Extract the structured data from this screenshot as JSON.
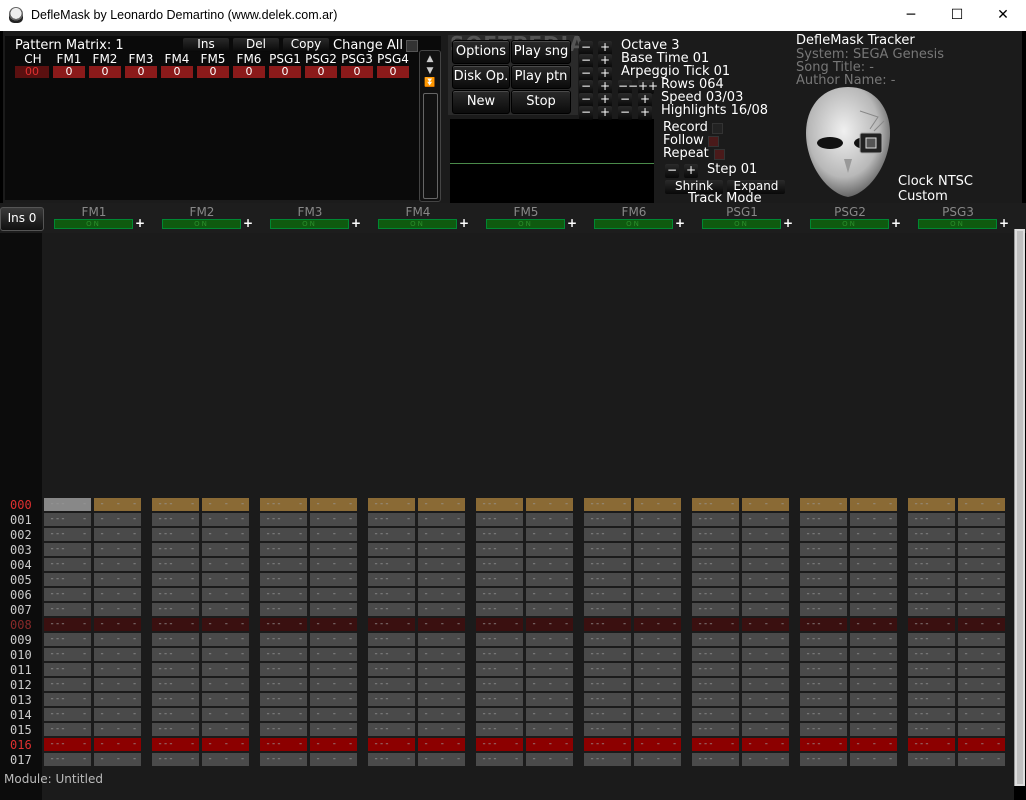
{
  "window": {
    "title": "DefleMask by Leonardo Demartino (www.delek.com.ar)",
    "minimize": "─",
    "maximize": "☐",
    "close": "✕"
  },
  "pattern_matrix": {
    "label": "Pattern Matrix: 1",
    "ins_label": "Ins",
    "del_label": "Del",
    "copy_label": "Copy",
    "change_all_label": "Change All",
    "ch_header": "CH",
    "columns": [
      "FM1",
      "FM2",
      "FM3",
      "FM4",
      "FM5",
      "FM6",
      "PSG1",
      "PSG2",
      "PSG3",
      "PSG4"
    ],
    "row_label": "00",
    "row_values": [
      "0",
      "0",
      "0",
      "0",
      "0",
      "0",
      "0",
      "0",
      "0",
      "0"
    ]
  },
  "controls": {
    "options": "Options",
    "play_song": "Play sng",
    "disk_op": "Disk Op.",
    "play_pattern": "Play ptn",
    "new": "New",
    "stop": "Stop",
    "watermark": "SOFTPEDIA"
  },
  "settings": {
    "minus": "−",
    "plus": "+",
    "octave": "Octave 3",
    "base_time": "Base Time 01",
    "arpeggio_tick": "Arpeggio Tick 01",
    "rows": "Rows 064",
    "rows_dec_big": "−−",
    "rows_inc_big": "++",
    "speed": "Speed 03/03",
    "highlights": "Highlights 16/08",
    "record": "Record",
    "follow": "Follow",
    "repeat": "Repeat",
    "step": "Step 01",
    "shrink": "Shrink",
    "expand": "Expand",
    "track_mode": "Track Mode"
  },
  "info": {
    "app_name": "DefleMask Tracker",
    "system": "System: SEGA Genesis",
    "song_title": "Song Title: -",
    "author": "Author Name: -",
    "clock_label": "Clock",
    "clock_value": "NTSC",
    "custom": "Custom"
  },
  "channels": {
    "ins": "Ins 0",
    "names": [
      "FM1",
      "FM2",
      "FM3",
      "FM4",
      "FM5",
      "FM6",
      "PSG1",
      "PSG2",
      "PSG3"
    ],
    "on_label": "ON",
    "plus": "+"
  },
  "rows": [
    "000",
    "001",
    "002",
    "003",
    "004",
    "005",
    "006",
    "007",
    "008",
    "009",
    "010",
    "011",
    "012",
    "013",
    "014",
    "015",
    "016",
    "017"
  ],
  "status": {
    "module": "Module: Untitled"
  },
  "colors": {
    "background": "#1b1b1b",
    "current_row": "#8a6a35",
    "highlight_8": "#3a1010",
    "highlight_16": "#8c0000",
    "cell": "#4a4a4a",
    "on_green": "#0f5a0f",
    "matrix_cell": "#8b1a1a"
  }
}
